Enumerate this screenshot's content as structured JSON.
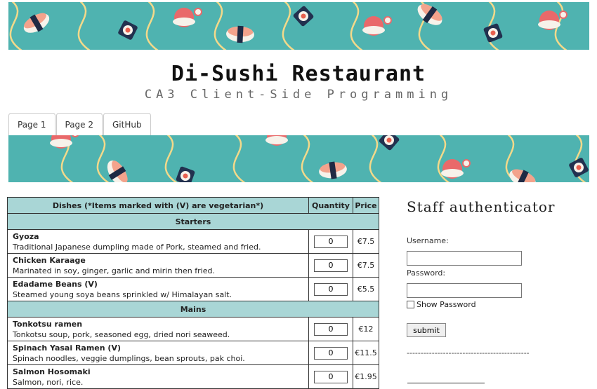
{
  "header": {
    "title": "Di-Sushi Restaurant",
    "subtitle": "CA3 Client-Side Programming"
  },
  "tabs": [
    {
      "label": "Page 1"
    },
    {
      "label": "Page 2"
    },
    {
      "label": "GitHub"
    }
  ],
  "menu": {
    "headers": {
      "dishes": "Dishes (*Items marked with (V) are vegetarian*)",
      "quantity": "Quantity",
      "price": "Price"
    },
    "sections": [
      {
        "name": "Starters",
        "items": [
          {
            "name": "Gyoza",
            "desc": "Traditional Japanese dumpling made of Pork, steamed and fried.",
            "qty": "0",
            "price": "€7.5"
          },
          {
            "name": "Chicken Karaage",
            "desc": "Marinated in soy, ginger, garlic and mirin then fried.",
            "qty": "0",
            "price": "€7.5"
          },
          {
            "name": "Edadame Beans (V)",
            "desc": "Steamed young soya beans sprinkled w/ Himalayan salt.",
            "qty": "0",
            "price": "€5.5"
          }
        ]
      },
      {
        "name": "Mains",
        "items": [
          {
            "name": "Tonkotsu ramen",
            "desc": "Tonkotsu soup, pork, seasoned egg, dried nori seaweed.",
            "qty": "0",
            "price": "€12"
          },
          {
            "name": "Spinach Yasai Ramen (V)",
            "desc": "Spinach noodles, veggie dumplings, bean sprouts, pak choi.",
            "qty": "0",
            "price": "€11.5"
          },
          {
            "name": "Salmon Hosomaki",
            "desc": "Salmon, nori, rice.",
            "qty": "0",
            "price": "€1.95"
          }
        ]
      }
    ]
  },
  "staff": {
    "title": "Staff authenticator",
    "username_label": "Username:",
    "password_label": "Password:",
    "show_password_label": "Show Password",
    "submit_label": "submit",
    "divider": "--------------------------------------------"
  }
}
